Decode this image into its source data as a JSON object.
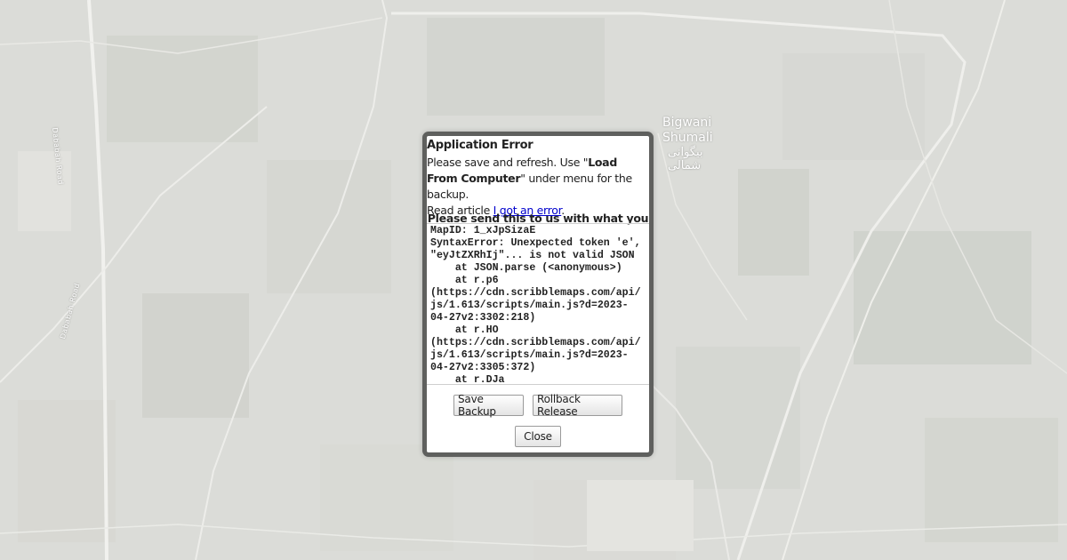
{
  "map": {
    "place_label_en_line1": "Bigwani",
    "place_label_en_line2": "Shumali",
    "place_label_local": "بیگوانی شمالی",
    "road_label_1": "Dababah Road",
    "road_label_2": "Dababah Road"
  },
  "dialog": {
    "title": "Application Error",
    "msg_prefix": "Please save and refresh. Use \"",
    "msg_bold": "Load From Computer",
    "msg_mid": "\" under menu for the backup.",
    "msg_read": "Read article ",
    "msg_link": "I got an error",
    "msg_end": ".",
    "send_note": "Please send this to us with what you",
    "trace": "MapID: 1_xJpSizaE\nSyntaxError: Unexpected token 'e',\n\"eyJtZXRhIj\"... is not valid JSON\n    at JSON.parse (<anonymous>)\n    at r.p6\n(https://cdn.scribblemaps.com/api/\njs/1.613/scripts/main.js?d=2023-\n04-27v2:3302:218)\n    at r.HO\n(https://cdn.scribblemaps.com/api/\njs/1.613/scripts/main.js?d=2023-\n04-27v2:3305:372)\n    at r.DJa",
    "save_backup_label": "Save Backup",
    "rollback_label": "Rollback Release",
    "close_label": "Close"
  }
}
